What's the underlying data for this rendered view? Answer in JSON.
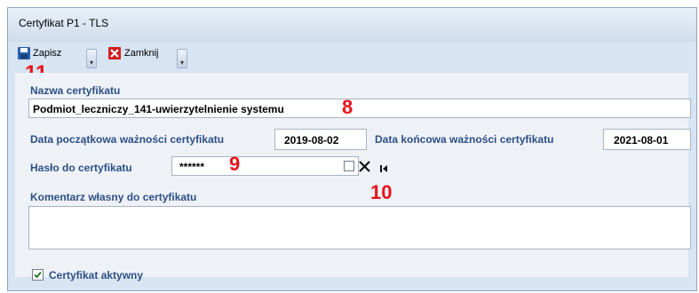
{
  "window": {
    "title": "Certyfikat P1 - TLS"
  },
  "toolbar": {
    "save_label": "Zapisz",
    "close_label": "Zamknij"
  },
  "form": {
    "name_label": "Nazwa certyfikatu",
    "name_value": "Podmiot_leczniczy_141-uwierzytelnienie systemu",
    "start_label": "Data początkowa ważności certyfikatu",
    "start_value": "2019-08-02",
    "end_label": "Data końcowa ważności certyfikatu",
    "end_value": "2021-08-01",
    "password_label": "Hasło do certyfikatu",
    "password_value": "******",
    "comment_label": "Komentarz własny do certyfikatu",
    "comment_value": "",
    "active_label": "Certyfikat aktywny",
    "active_checked": true
  },
  "annotations": {
    "n8": "8",
    "n9": "9",
    "n10": "10",
    "n11": "11"
  },
  "icons": {
    "save": "save-icon",
    "close": "close-icon",
    "clear": "clear-x-icon",
    "first": "first-record-icon"
  },
  "colors": {
    "label": "#2c4f86",
    "annotation": "#e8131b",
    "window_bg": "#d7e4f2"
  }
}
